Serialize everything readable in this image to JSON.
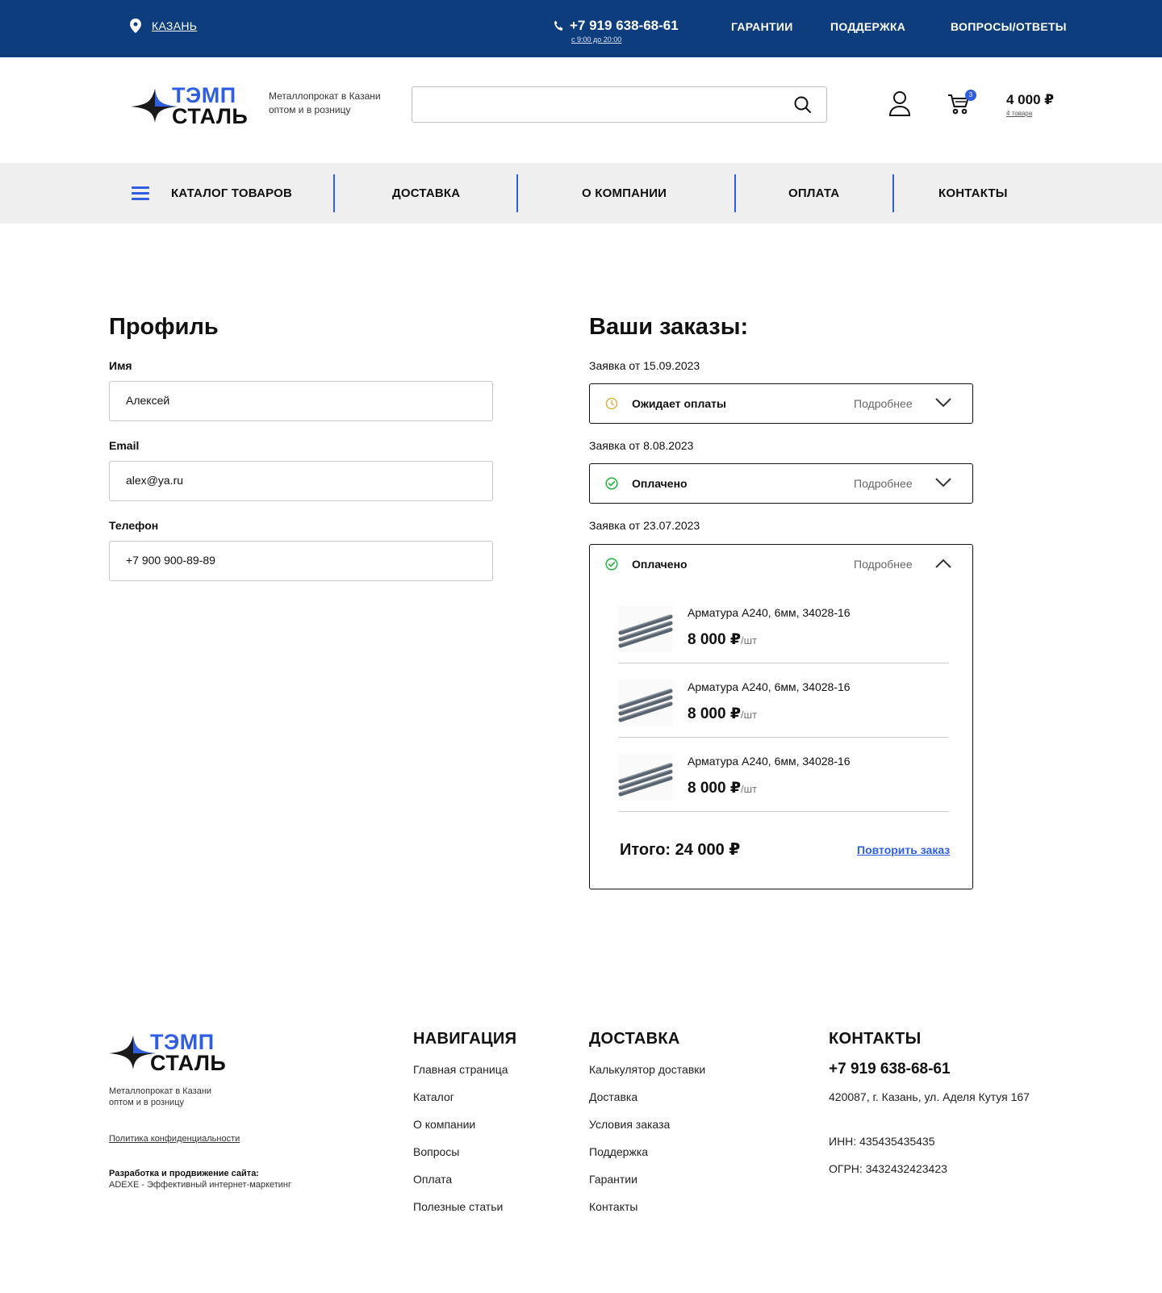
{
  "topbar": {
    "city": "КАЗАНЬ",
    "phone": "+7 919 638-68-61",
    "hours": "с 9:00 до 20:00",
    "links": [
      "ГАРАНТИИ",
      "ПОДДЕРЖКА",
      "ВОПРОСЫ/ОТВЕТЫ"
    ]
  },
  "brand": {
    "line1": "ТЭМП",
    "line2": "СТАЛЬ",
    "tagline1": "Металлопрокат в Казани",
    "tagline2": "оптом и в розницу"
  },
  "search": {
    "placeholder": ""
  },
  "cart": {
    "badge": "3",
    "sum": "4 000 ₽",
    "count": "4 товара"
  },
  "nav": [
    "КАТАЛОГ ТОВАРОВ",
    "ДОСТАВКА",
    "О КОМПАНИИ",
    "ОПЛАТА",
    "КОНТАКТЫ"
  ],
  "profile": {
    "title": "Профиль",
    "name_label": "Имя",
    "name_value": "Алексей",
    "email_label": "Email",
    "email_value": "alex@ya.ru",
    "phone_label": "Телефон",
    "phone_value": "+7 900 900-89-89"
  },
  "orders": {
    "title": "Ваши заказы:",
    "more_label": "Подробнее",
    "items": [
      {
        "date": "Заявка от 15.09.2023",
        "status": "Ожидает оплаты",
        "status_color": "#e0b14a"
      },
      {
        "date": "Заявка от 8.08.2023",
        "status": "Оплачено",
        "status_color": "#2fb24a"
      },
      {
        "date": "Заявка от 23.07.2023",
        "status": "Оплачено",
        "status_color": "#2fb24a"
      }
    ],
    "products": [
      {
        "name": "Арматура А240, 6мм,  34028-16",
        "price": "8 000 ₽",
        "unit": "/шт"
      },
      {
        "name": "Арматура А240, 6мм,  34028-16",
        "price": "8 000 ₽",
        "unit": "/шт"
      },
      {
        "name": "Арматура А240, 6мм,  34028-16",
        "price": "8 000 ₽",
        "unit": "/шт"
      }
    ],
    "total": "Итого: 24 000 ₽",
    "repeat": "Повторить заказ"
  },
  "footer": {
    "tagline1": "Металлопрокат в Казани",
    "tagline2": "оптом и в розницу",
    "policy": "Политика конфиденциальности",
    "dev_title": "Разработка и продвижение сайта:",
    "dev_text": "ADEXE - Эффективный интернет-маркетинг",
    "nav_title": "НАВИГАЦИЯ",
    "nav_links": [
      "Главная страница",
      "Каталог",
      "О компании",
      "Вопросы",
      "Оплата",
      "Полезные статьи"
    ],
    "delivery_title": "ДОСТАВКА",
    "delivery_links": [
      "Калькулятор доставки",
      "Доставка",
      "Условия заказа",
      "Поддержка",
      "Гарантии",
      "Контакты"
    ],
    "contacts_title": "КОНТАКТЫ",
    "phone": "+7 919 638-68-61",
    "address": "420087,  г. Казань, ул. Аделя Кутуя 167",
    "inn": "ИНН: 435435435435",
    "ogrn": "ОГРН: 3432432423423"
  },
  "colors": {
    "topbar": "#0e3d7d",
    "accent": "#2f5fe0",
    "nav_bg": "#efefef"
  }
}
